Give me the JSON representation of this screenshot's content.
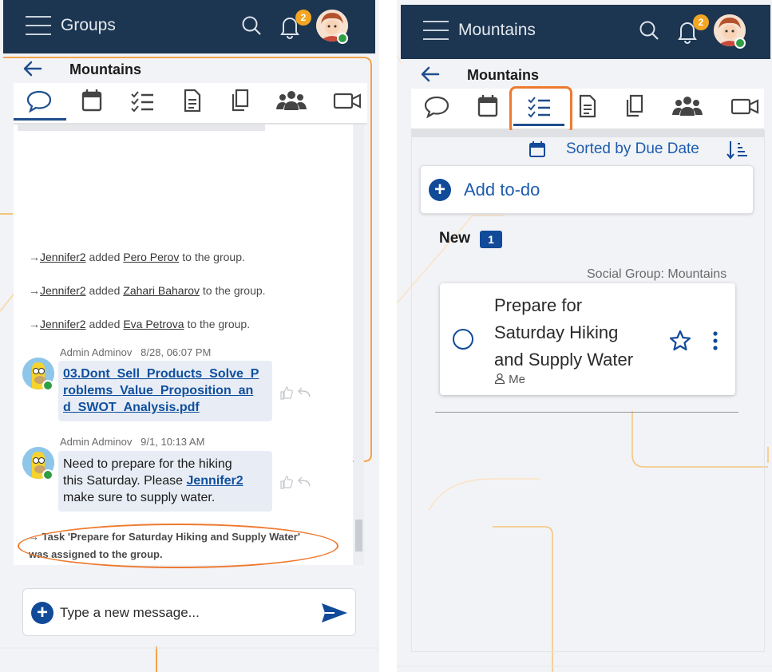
{
  "left": {
    "appbar": {
      "title": "Groups",
      "notification_count": "2"
    },
    "group_name": "Mountains",
    "tabs": [
      "chat",
      "calendar",
      "tasks",
      "document",
      "files",
      "members",
      "video"
    ],
    "system_messages": [
      {
        "arrow": "→",
        "actor": "Jennifer2",
        "verb": "added",
        "target": "Pero Perov",
        "suffix": "to the group."
      },
      {
        "arrow": "→",
        "actor": "Jennifer2",
        "verb": "added",
        "target": "Zahari Baharov",
        "suffix": "to the group."
      },
      {
        "arrow": "→",
        "actor": "Jennifer2",
        "verb": "added",
        "target": "Eva Petrova",
        "suffix": "to the group."
      }
    ],
    "messages": [
      {
        "author": "Admin Adminov",
        "time": "8/28, 06:07 PM",
        "file_line1": "03.Dont_Sell_Products_Solve_P",
        "file_line2": "roblems_Value_Proposition_an",
        "file_line3": "d_SWOT_Analysis.pdf"
      },
      {
        "author": "Admin Adminov",
        "time": "9/1, 10:13 AM",
        "text_line1": "Need to prepare for the hiking",
        "text_line2a": "this Saturday. Please",
        "mention": "Jennifer2",
        "text_line3": "make sure to supply water."
      }
    ],
    "task_notice_line1": "→ Task 'Prepare for Saturday Hiking and Supply Water'",
    "task_notice_line2": "was assigned to the group.",
    "composer_placeholder": "Type a new message..."
  },
  "right": {
    "appbar": {
      "title": "Mountains",
      "notification_count": "2"
    },
    "group_name": "Mountains",
    "sort_label": "Sorted by Due Date",
    "add_todo_label": "Add to-do",
    "section_title": "New",
    "section_count": "1",
    "task_source": "Social Group: Mountains",
    "task_title_line1": "Prepare for",
    "task_title_line2": "Saturday Hiking",
    "task_title_line3": "and Supply Water",
    "task_assignee": "Me"
  },
  "colors": {
    "appbar": "#1c3550",
    "accent": "#114a98",
    "highlight": "#ee7a30",
    "badge": "#f2a623",
    "online": "#2f9e44"
  }
}
